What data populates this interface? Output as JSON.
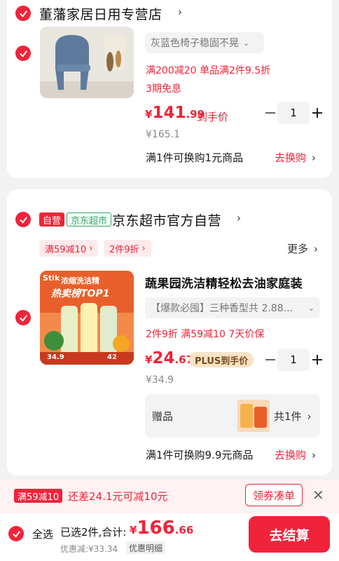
{
  "store1": {
    "name": "董藩家居日用专营店",
    "item": {
      "spec": "灰蓝色椅子稳固不晃",
      "promo1": "满200减20  单品满2件9.5折",
      "promo2": "3期免息",
      "price_currency": "¥",
      "price_int": "141",
      "price_dec": ".99",
      "price_label": "到手价",
      "orig_price": "¥165.1",
      "qty": "1"
    },
    "swap_text": "满1件可换购1元商品",
    "swap_link": "去换购"
  },
  "store2": {
    "tag_self": "自营",
    "tag_jd": "京东超市",
    "name": "京东超市官方自营",
    "pills": [
      "满59减10",
      "2件9折"
    ],
    "more": "更多",
    "item": {
      "title": "蔬果园洗洁精轻松去油家庭装",
      "spec": "【爆款必囤】三种香型共 2.88...",
      "tags": "2件9折  满59减10  7天价保",
      "price_currency": "¥",
      "price_int": "24",
      "price_dec": ".67",
      "plus_label": "PLUS到手价",
      "orig_price": "¥34.9",
      "qty": "1",
      "thumb_text": {
        "brand": "Stik",
        "headline": "浓缩洗洁精",
        "badge": "热卖榜TOP1",
        "price_a": "34.9",
        "price_b": "42"
      }
    },
    "gift": {
      "label": "赠品",
      "count": "共1件"
    },
    "swap_text": "满1件可换购9.9元商品",
    "swap_link": "去换购"
  },
  "coupon_bar": {
    "tag": "满59减10",
    "message": "还差24.1元可减10元",
    "button": "领券凑单"
  },
  "bottom_bar": {
    "select_all": "全选",
    "selected": "已选2件,合计:",
    "total_currency": "¥",
    "total_int": "166",
    "total_dec": ".66",
    "discount": "优惠减:¥33.34",
    "detail": "优惠明细",
    "checkout": "去结算"
  },
  "colors": {
    "accent": "#f0233a",
    "jd_green": "#37a86b"
  }
}
